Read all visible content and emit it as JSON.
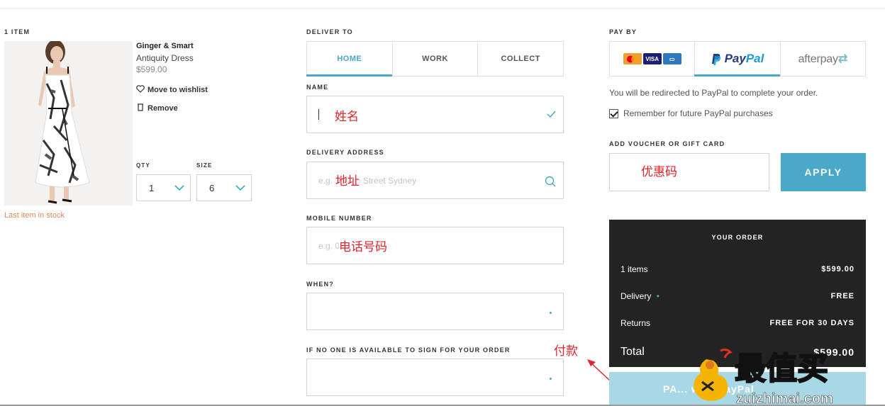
{
  "cart": {
    "heading": "1 ITEM",
    "brand": "Ginger & Smart",
    "product_name": "Antiquity Dress",
    "price": "$599.00",
    "move_to_wishlist": "Move to wishlist",
    "remove": "Remove",
    "qty_label": "QTY",
    "qty_value": "1",
    "size_label": "SIZE",
    "size_value": "6",
    "stock_note": "Last item in stock"
  },
  "delivery": {
    "heading": "DELIVER TO",
    "tabs": [
      "HOME",
      "WORK",
      "COLLECT"
    ],
    "active_tab": "HOME",
    "name_label": "NAME",
    "name_annotation": "姓名",
    "address_label": "DELIVERY ADDRESS",
    "address_placeholder": "e.g. 2 Main Street Sydney",
    "address_annotation": "地址",
    "mobile_label": "MOBILE NUMBER",
    "mobile_placeholder": "e.g. 0",
    "mobile_annotation": "电话号码",
    "when_label": "WHEN?",
    "sign_label": "IF NO ONE IS AVAILABLE TO SIGN FOR YOUR ORDER"
  },
  "payment": {
    "heading": "PAY BY",
    "methods": [
      "Cards",
      "PayPal",
      "afterpay"
    ],
    "active_method": "PayPal",
    "redirect_note": "You will be redirected to PayPal to complete your order.",
    "remember_label": "Remember for future PayPal purchases",
    "remember_checked": true,
    "voucher_label": "ADD VOUCHER OR GIFT CARD",
    "voucher_annotation": "优惠码",
    "apply_label": "APPLY",
    "pay_annotation": "付款",
    "pay_button_label": "PA... with PayPal"
  },
  "order": {
    "title": "YOUR ORDER",
    "items_label": "1 items",
    "items_value": "$599.00",
    "delivery_label": "Delivery",
    "delivery_value": "FREE",
    "returns_label": "Returns",
    "returns_value": "FREE FOR 30 DAYS",
    "total_label": "Total",
    "total_value": "$599.00"
  },
  "watermark": {
    "cn": "最值买",
    "url": "zuizhimai.com"
  },
  "colors": {
    "accent": "#4aa8c8",
    "stock_warning": "#e88858",
    "annotation": "#e0242c",
    "order_bg": "#232323"
  },
  "icons": [
    "heart-icon",
    "trash-icon",
    "chevron-down-icon",
    "check-icon",
    "search-icon",
    "arrow-icon"
  ]
}
